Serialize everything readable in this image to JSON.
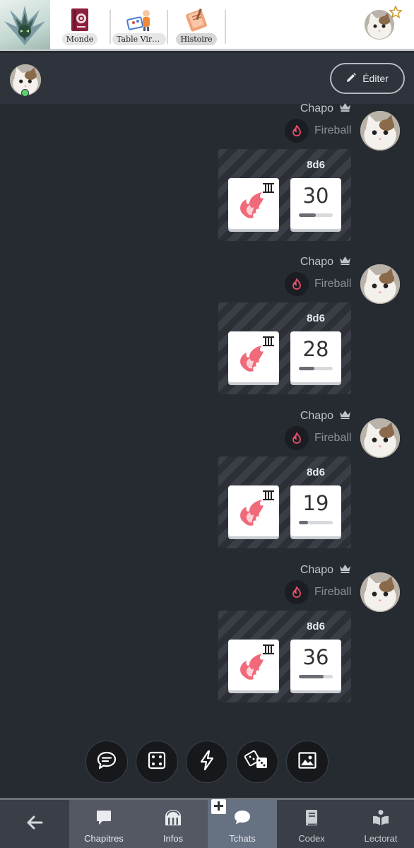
{
  "top_nav": {
    "tabs": [
      {
        "label": "Monde",
        "icon": "book-icon"
      },
      {
        "label": "Table Virtuelle",
        "icon": "table-game-icon"
      },
      {
        "label": "Histoire",
        "icon": "scroll-book-icon"
      }
    ],
    "active_tab": "Histoire"
  },
  "chat_header": {
    "status": "online",
    "edit_label": "Éditer"
  },
  "messages": [
    {
      "author": "Chapo",
      "action": "Fireball",
      "formula": "8d6",
      "total": "30",
      "progress": 0.5,
      "die_level": "III"
    },
    {
      "author": "Chapo",
      "action": "Fireball",
      "formula": "8d6",
      "total": "28",
      "progress": 0.45,
      "die_level": "III"
    },
    {
      "author": "Chapo",
      "action": "Fireball",
      "formula": "8d6",
      "total": "19",
      "progress": 0.28,
      "die_level": "III"
    },
    {
      "author": "Chapo",
      "action": "Fireball",
      "formula": "8d6",
      "total": "36",
      "progress": 0.72,
      "die_level": "III"
    }
  ],
  "action_bar": [
    "chat-bubble-icon",
    "dice-icon",
    "lightning-icon",
    "two-dice-icon",
    "image-icon"
  ],
  "bottom_nav": {
    "items": [
      {
        "label": "Chapitres",
        "icon": "comment-icon"
      },
      {
        "label": "Infos",
        "icon": "arch-icon"
      },
      {
        "label": "Tchats",
        "icon": "chat-icon"
      },
      {
        "label": "Codex",
        "icon": "book-closed-icon"
      },
      {
        "label": "Lectorat",
        "icon": "reader-icon"
      }
    ],
    "active": "Tchats"
  },
  "colors": {
    "background": "#262a31",
    "header": "#2f333b",
    "online": "#5bd26e",
    "fire": "#e8506a",
    "active_nav": "#667182"
  }
}
